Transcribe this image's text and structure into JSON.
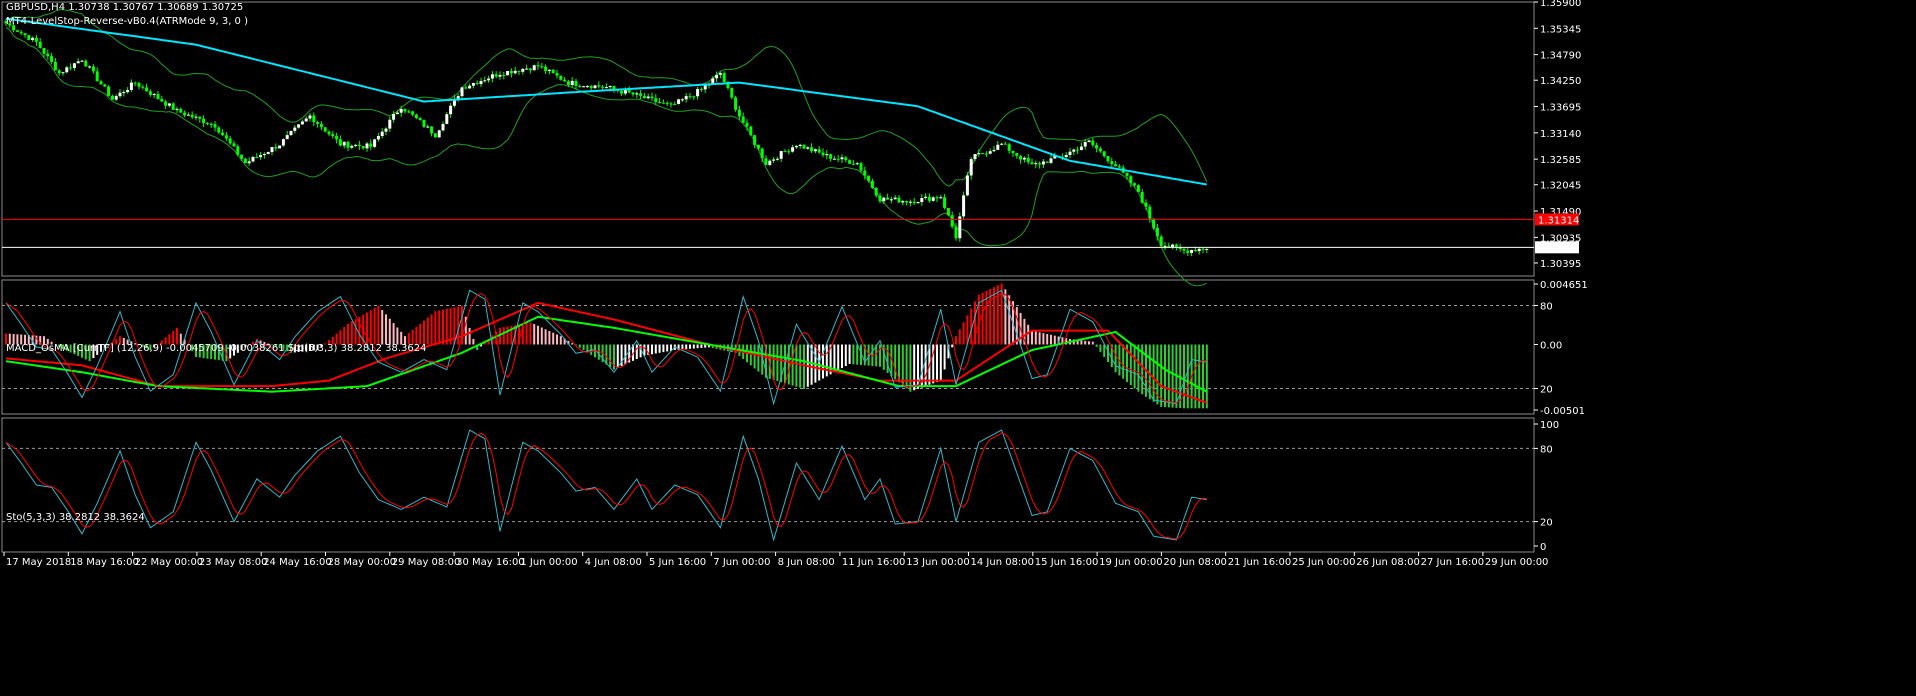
{
  "header": {
    "symbol_line": "GBPUSD,H4  1.30738 1.30767 1.30689 1.30725",
    "indicator_line": "MT4-LevelStop-Reverse-vB0.4(ATRMode 9, 3, 0 )"
  },
  "macd_panel": {
    "label": "MACD_OsMA [CurrTF] (12,26,9) -0.0045709 -0.0038261  Sto(5,3,3) 38.2812 38.3624"
  },
  "sto_panel": {
    "label": "Sto(5,3,3) 38.2812 38.3624"
  },
  "colors": {
    "candle_bull": "#ffffff",
    "candle_bear": "#00ff00",
    "ma": "#00e5ff",
    "bands": "#1f9f1f",
    "hline": "#ff0000",
    "sto_main": "#30b8c8",
    "sto_signal": "#ff0000",
    "osma_pos": "#ff0000",
    "osma_pos_fall": "#ffb6c1",
    "osma_neg": "#32cd32",
    "osma_neg_rise": "#ffffff",
    "macd_signal_green": "#00ff00"
  },
  "chart_data": [
    {
      "type": "candlestick",
      "symbol": "GBPUSD",
      "timeframe": "H4",
      "last": {
        "open": 1.30738,
        "high": 1.30767,
        "low": 1.30689,
        "close": 1.30725
      },
      "ylim": [
        1.3012,
        1.359
      ],
      "y_ticks": [
        "1.35900",
        "1.35345",
        "1.34790",
        "1.34250",
        "1.33695",
        "1.33140",
        "1.32585",
        "1.32045",
        "1.31490",
        "1.30935",
        "1.30395"
      ],
      "y_tick_values": [
        1.359,
        1.35345,
        1.3479,
        1.3425,
        1.33695,
        1.3314,
        1.32585,
        1.32045,
        1.3149,
        1.30935,
        1.30395
      ],
      "price_markers": [
        {
          "label": "1.31314",
          "value": 1.31314,
          "color": "#ff0000"
        },
        {
          "label": "1.30725",
          "value": 1.30725,
          "color": "#ffffff"
        }
      ],
      "close_keypoints": [
        [
          0,
          1.3545
        ],
        [
          8,
          1.3505
        ],
        [
          14,
          1.344
        ],
        [
          20,
          1.347
        ],
        [
          28,
          1.3385
        ],
        [
          34,
          1.342
        ],
        [
          45,
          1.336
        ],
        [
          55,
          1.333
        ],
        [
          63,
          1.325
        ],
        [
          72,
          1.329
        ],
        [
          80,
          1.335
        ],
        [
          88,
          1.329
        ],
        [
          96,
          1.3285
        ],
        [
          104,
          1.337
        ],
        [
          113,
          1.331
        ],
        [
          120,
          1.341
        ],
        [
          130,
          1.344
        ],
        [
          140,
          1.3455
        ],
        [
          148,
          1.342
        ],
        [
          158,
          1.341
        ],
        [
          165,
          1.3395
        ],
        [
          175,
          1.337
        ],
        [
          183,
          1.3405
        ],
        [
          188,
          1.344
        ],
        [
          193,
          1.335
        ],
        [
          200,
          1.325
        ],
        [
          208,
          1.329
        ],
        [
          216,
          1.3265
        ],
        [
          224,
          1.325
        ],
        [
          230,
          1.3175
        ],
        [
          238,
          1.317
        ],
        [
          246,
          1.318
        ],
        [
          250,
          1.3095
        ],
        [
          254,
          1.326
        ],
        [
          262,
          1.329
        ],
        [
          270,
          1.3245
        ],
        [
          278,
          1.3265
        ],
        [
          285,
          1.3295
        ],
        [
          292,
          1.3245
        ],
        [
          298,
          1.319
        ],
        [
          304,
          1.308
        ],
        [
          310,
          1.3065
        ],
        [
          316,
          1.3072
        ]
      ],
      "ma_keypoints": [
        [
          0,
          1.3555
        ],
        [
          50,
          1.35
        ],
        [
          110,
          1.338
        ],
        [
          150,
          1.34
        ],
        [
          193,
          1.342
        ],
        [
          240,
          1.337
        ],
        [
          280,
          1.3255
        ],
        [
          316,
          1.3205
        ]
      ],
      "x_ticks": [
        "17 May 2018",
        "18 May 16:00",
        "22 May 00:00",
        "23 May 08:00",
        "24 May 16:00",
        "28 May 00:00",
        "29 May 08:00",
        "30 May 16:00",
        "1 Jun 00:00",
        "4 Jun 08:00",
        "5 Jun 16:00",
        "7 Jun 00:00",
        "8 Jun 08:00",
        "11 Jun 16:00",
        "13 Jun 00:00",
        "14 Jun 08:00",
        "15 Jun 16:00",
        "19 Jun 00:00",
        "20 Jun 08:00",
        "21 Jun 16:00",
        "25 Jun 00:00",
        "26 Jun 08:00",
        "27 Jun 16:00",
        "29 Jun 00:00"
      ]
    },
    {
      "type": "bar",
      "name": "MACD_OsMA [CurrTF] (12,26,9)",
      "values_last": [
        -0.0045709,
        -0.0038261
      ],
      "ylim": [
        -0.00501,
        0.004651
      ],
      "y_ticks": [
        "0.004651",
        "80",
        "0.00",
        "20",
        "-0.00501"
      ],
      "osma_keypoints": [
        [
          0,
          0.0008
        ],
        [
          10,
          0.0006
        ],
        [
          14,
          -0.0002
        ],
        [
          22,
          -0.0012
        ],
        [
          30,
          0.0006
        ],
        [
          38,
          -0.0004
        ],
        [
          45,
          0.0012
        ],
        [
          50,
          -0.0009
        ],
        [
          58,
          -0.0012
        ],
        [
          66,
          0.0004
        ],
        [
          75,
          -0.0006
        ],
        [
          82,
          -0.0004
        ],
        [
          90,
          0.0015
        ],
        [
          98,
          0.0028
        ],
        [
          105,
          0.0006
        ],
        [
          113,
          0.0024
        ],
        [
          120,
          0.0028
        ],
        [
          124,
          -0.0004
        ],
        [
          130,
          0.0012
        ],
        [
          138,
          0.0016
        ],
        [
          146,
          0.0006
        ],
        [
          152,
          -0.0004
        ],
        [
          160,
          -0.0018
        ],
        [
          168,
          -0.0008
        ],
        [
          176,
          -0.0004
        ],
        [
          185,
          -0.0002
        ],
        [
          192,
          -0.0006
        ],
        [
          200,
          -0.0024
        ],
        [
          210,
          -0.0032
        ],
        [
          222,
          -0.0014
        ],
        [
          230,
          -0.0016
        ],
        [
          238,
          -0.0034
        ],
        [
          246,
          -0.0026
        ],
        [
          250,
          0.0006
        ],
        [
          256,
          0.0036
        ],
        [
          262,
          0.0044
        ],
        [
          270,
          0.001
        ],
        [
          280,
          0.0004
        ],
        [
          286,
          0.0002
        ],
        [
          292,
          -0.002
        ],
        [
          298,
          -0.0034
        ],
        [
          304,
          -0.0045
        ],
        [
          310,
          -0.0046
        ],
        [
          316,
          -0.0046
        ]
      ],
      "signal_red_keypoints": [
        [
          0,
          -0.001
        ],
        [
          20,
          -0.0015
        ],
        [
          40,
          -0.003
        ],
        [
          70,
          -0.003
        ],
        [
          85,
          -0.0026
        ],
        [
          100,
          -0.001
        ],
        [
          120,
          0.0006
        ],
        [
          140,
          0.003
        ],
        [
          160,
          0.0018
        ],
        [
          185,
          0.0
        ],
        [
          210,
          -0.0015
        ],
        [
          230,
          -0.0026
        ],
        [
          250,
          -0.0026
        ],
        [
          270,
          0.001
        ],
        [
          290,
          0.001
        ],
        [
          304,
          -0.003
        ],
        [
          316,
          -0.0042
        ]
      ],
      "signal_green_keypoints": [
        [
          0,
          -0.0012
        ],
        [
          20,
          -0.002
        ],
        [
          40,
          -0.003
        ],
        [
          70,
          -0.0034
        ],
        [
          95,
          -0.003
        ],
        [
          120,
          -0.0006
        ],
        [
          140,
          0.002
        ],
        [
          160,
          0.0012
        ],
        [
          185,
          0.0
        ],
        [
          210,
          -0.0012
        ],
        [
          235,
          -0.003
        ],
        [
          250,
          -0.003
        ],
        [
          270,
          -0.0004
        ],
        [
          292,
          0.0009
        ],
        [
          305,
          -0.0018
        ],
        [
          316,
          -0.0034
        ]
      ]
    },
    {
      "type": "line",
      "name": "Sto(5,3,3)",
      "values_last": [
        38.2812,
        38.3624
      ],
      "ylim": [
        0,
        100
      ],
      "y_ticks": [
        "100",
        "80",
        "20",
        "0"
      ],
      "levels": [
        80,
        20
      ],
      "sto_keypoints": [
        [
          0,
          85
        ],
        [
          4,
          68
        ],
        [
          8,
          50
        ],
        [
          12,
          48
        ],
        [
          16,
          30
        ],
        [
          20,
          10
        ],
        [
          24,
          35
        ],
        [
          30,
          78
        ],
        [
          34,
          42
        ],
        [
          38,
          15
        ],
        [
          44,
          28
        ],
        [
          50,
          85
        ],
        [
          54,
          62
        ],
        [
          60,
          20
        ],
        [
          66,
          55
        ],
        [
          72,
          40
        ],
        [
          76,
          58
        ],
        [
          82,
          78
        ],
        [
          88,
          90
        ],
        [
          93,
          60
        ],
        [
          98,
          38
        ],
        [
          104,
          30
        ],
        [
          110,
          40
        ],
        [
          116,
          32
        ],
        [
          122,
          95
        ],
        [
          126,
          88
        ],
        [
          130,
          12
        ],
        [
          136,
          85
        ],
        [
          140,
          78
        ],
        [
          146,
          60
        ],
        [
          150,
          45
        ],
        [
          155,
          48
        ],
        [
          160,
          30
        ],
        [
          166,
          55
        ],
        [
          170,
          30
        ],
        [
          176,
          50
        ],
        [
          182,
          42
        ],
        [
          188,
          15
        ],
        [
          194,
          90
        ],
        [
          198,
          55
        ],
        [
          202,
          5
        ],
        [
          208,
          68
        ],
        [
          214,
          38
        ],
        [
          220,
          82
        ],
        [
          226,
          38
        ],
        [
          230,
          55
        ],
        [
          234,
          18
        ],
        [
          240,
          20
        ],
        [
          246,
          80
        ],
        [
          250,
          20
        ],
        [
          256,
          85
        ],
        [
          262,
          95
        ],
        [
          266,
          60
        ],
        [
          270,
          25
        ],
        [
          274,
          28
        ],
        [
          280,
          80
        ],
        [
          286,
          70
        ],
        [
          292,
          35
        ],
        [
          298,
          28
        ],
        [
          302,
          8
        ],
        [
          308,
          5
        ],
        [
          312,
          40
        ],
        [
          316,
          38
        ]
      ]
    }
  ]
}
